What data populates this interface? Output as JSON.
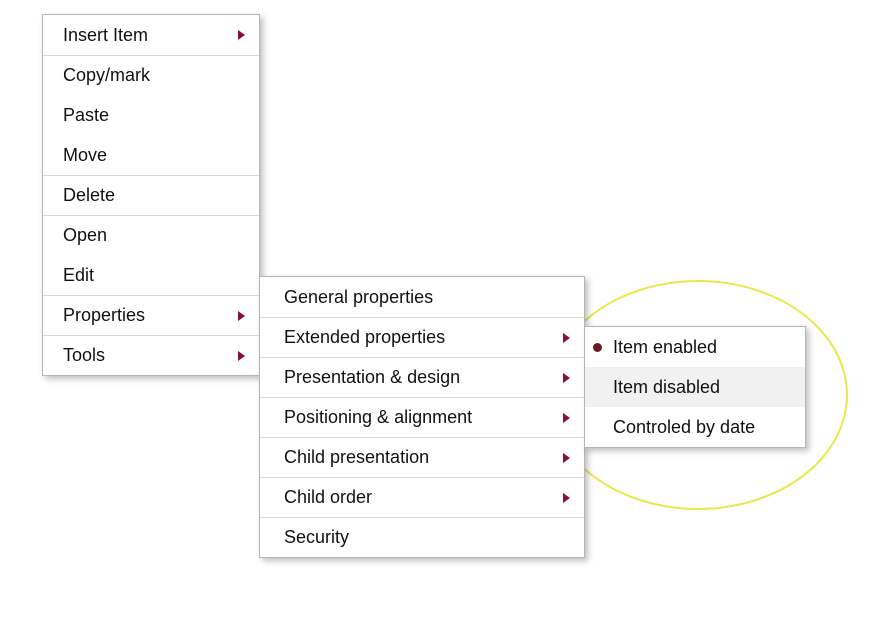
{
  "menu1": {
    "items": [
      {
        "label": "Insert Item",
        "has_submenu": true
      },
      {
        "label": "Copy/mark",
        "has_submenu": false,
        "sep_top": true
      },
      {
        "label": "Paste",
        "has_submenu": false
      },
      {
        "label": "Move",
        "has_submenu": false
      },
      {
        "label": "Delete",
        "has_submenu": false,
        "sep_top": true
      },
      {
        "label": "Open",
        "has_submenu": false,
        "sep_top": true
      },
      {
        "label": "Edit",
        "has_submenu": false
      },
      {
        "label": "Properties",
        "has_submenu": true,
        "sep_top": true
      },
      {
        "label": "Tools",
        "has_submenu": true,
        "sep_top": true
      }
    ]
  },
  "menu2": {
    "items": [
      {
        "label": "General properties",
        "has_submenu": false
      },
      {
        "label": "Extended properties",
        "has_submenu": true,
        "sep_top": true
      },
      {
        "label": "Presentation & design",
        "has_submenu": true,
        "sep_top": true
      },
      {
        "label": "Positioning & alignment",
        "has_submenu": true,
        "sep_top": true
      },
      {
        "label": "Child presentation",
        "has_submenu": true,
        "sep_top": true
      },
      {
        "label": "Child order",
        "has_submenu": true,
        "sep_top": true
      },
      {
        "label": "Security",
        "has_submenu": false,
        "sep_top": true
      }
    ]
  },
  "menu3": {
    "items": [
      {
        "label": "Item enabled",
        "selected": true
      },
      {
        "label": "Item disabled",
        "hovered": true
      },
      {
        "label": "Controled by date"
      }
    ]
  },
  "colors": {
    "accent_arrow": "#8a0e2d",
    "highlight_ellipse": "#e8e84a"
  }
}
